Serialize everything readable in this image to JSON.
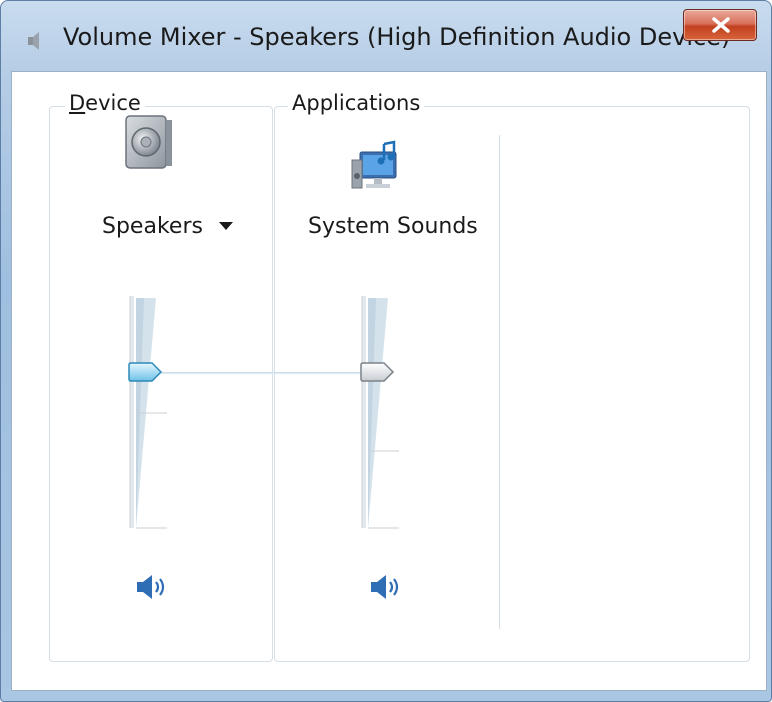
{
  "window": {
    "title": "Volume Mixer - Speakers (High Definition Audio Device)"
  },
  "device_group": {
    "label_hotkey": "D",
    "label_rest": "evice",
    "device_name": "Speakers",
    "volume_percent": 68,
    "muted": false
  },
  "applications_group": {
    "label": "Applications",
    "apps": [
      {
        "name": "System Sounds",
        "volume_percent": 68,
        "muted": false
      }
    ]
  },
  "icons": {
    "title": "speaker-icon",
    "close": "close-icon",
    "device": "speaker-device-icon",
    "app": "system-sounds-icon",
    "mute": "speaker-volume-icon"
  },
  "colors": {
    "accent": "#4a90c8",
    "close_button": "#c2401f",
    "frame": "#a9c6e3"
  }
}
